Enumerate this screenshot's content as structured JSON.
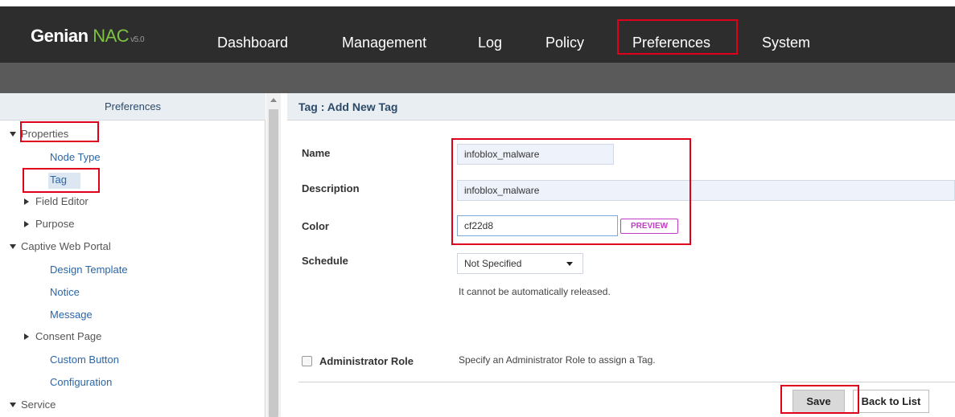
{
  "header": {
    "logo": {
      "brand": "Genian",
      "product": "NAC",
      "version": "v5.0"
    },
    "nav": [
      {
        "label": "Dashboard"
      },
      {
        "label": "Management"
      },
      {
        "label": "Log"
      },
      {
        "label": "Policy"
      },
      {
        "label": "Preferences"
      },
      {
        "label": "System"
      }
    ],
    "highlighted_nav": "Preferences"
  },
  "sidebar": {
    "title": "Preferences",
    "items": [
      {
        "label": "Properties",
        "kind": "category",
        "state": "expanded"
      },
      {
        "label": "Node Type",
        "kind": "link"
      },
      {
        "label": "Tag",
        "kind": "link",
        "selected": true
      },
      {
        "label": "Field Editor",
        "kind": "category",
        "state": "collapsed"
      },
      {
        "label": "Purpose",
        "kind": "category",
        "state": "collapsed"
      },
      {
        "label": "Captive Web Portal",
        "kind": "category",
        "state": "expanded"
      },
      {
        "label": "Design Template",
        "kind": "link"
      },
      {
        "label": "Notice",
        "kind": "link"
      },
      {
        "label": "Message",
        "kind": "link"
      },
      {
        "label": "Consent Page",
        "kind": "category",
        "state": "collapsed"
      },
      {
        "label": "Custom Button",
        "kind": "link"
      },
      {
        "label": "Configuration",
        "kind": "link"
      },
      {
        "label": "Service",
        "kind": "category",
        "state": "expanded"
      }
    ]
  },
  "main": {
    "title": "Tag : Add New Tag",
    "form": {
      "name_label": "Name",
      "name_value": "infoblox_malware",
      "description_label": "Description",
      "description_value": "infoblox_malware",
      "color_label": "Color",
      "color_value": "cf22d8",
      "preview_label": "PREVIEW",
      "schedule_label": "Schedule",
      "schedule_value": "Not Specified",
      "schedule_note": "It cannot be automatically released.",
      "admin_role_label": "Administrator Role",
      "admin_role_note": "Specify an Administrator Role to assign a Tag."
    },
    "buttons": {
      "save": "Save",
      "back": "Back to List"
    }
  },
  "colors": {
    "topbar": "#2d2d2d",
    "subbar": "#5a5a5a",
    "logo_accent": "#7dc242",
    "highlight_box": "#e0001b",
    "link": "#2a66a8",
    "preview_accent": "#c13cc6"
  },
  "icons": [
    "caret-down-icon",
    "caret-right-icon",
    "scroll-up-icon",
    "select-arrow-icon"
  ]
}
